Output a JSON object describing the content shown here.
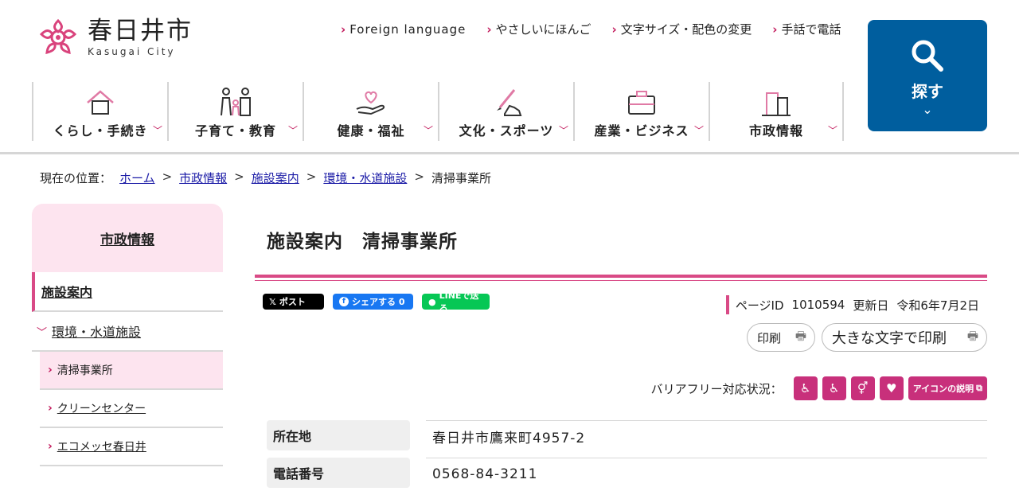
{
  "site": {
    "name_jp": "春日井市",
    "name_en": "Kasugai City",
    "brand_color": "#c2185b",
    "accent_blue": "#005e9e"
  },
  "utility_nav": [
    {
      "label": "Foreign language"
    },
    {
      "label": "やさしいにほんご"
    },
    {
      "label": "文字サイズ・配色の変更"
    },
    {
      "label": "手話で電話"
    }
  ],
  "search": {
    "label": "探す",
    "icon": "magnifier-icon"
  },
  "global_nav": [
    {
      "label": "くらし・手続き",
      "icon": "house-icon"
    },
    {
      "label": "子育て・教育",
      "icon": "family-icon"
    },
    {
      "label": "健康・福祉",
      "icon": "heart-hand-icon"
    },
    {
      "label": "文化・スポーツ",
      "icon": "brush-shoe-icon"
    },
    {
      "label": "産業・ビジネス",
      "icon": "briefcase-icon"
    },
    {
      "label": "市政情報",
      "icon": "building-icon"
    }
  ],
  "breadcrumb": {
    "prefix": "現在の位置：",
    "items": [
      "ホーム",
      "市政情報",
      "施設案内",
      "環境・水道施設"
    ],
    "current": "清掃事業所"
  },
  "sidebar": {
    "heading": "市政情報",
    "level1_active": "施設案内",
    "level1_open": "環境・水道施設",
    "items": [
      "清掃事業所",
      "クリーンセンター",
      "エコメッセ春日井"
    ]
  },
  "page": {
    "title": "施設案内　清掃事業所",
    "page_id_label": "ページID",
    "page_id": "1010594",
    "updated_label": "更新日",
    "updated": "令和6年7月2日"
  },
  "share": {
    "x": "ポスト",
    "facebook": "シェアする 0",
    "line": "LINEで送る"
  },
  "print": {
    "small": "印刷",
    "large": "大きな文字で印刷"
  },
  "barrier_free": {
    "label": "バリアフリー対応状況：",
    "icons": [
      "wheelchair-parking-icon",
      "wheelchair-slope-icon",
      "accessible-toilet-icon",
      "aed-icon"
    ],
    "explain": "アイコンの説明"
  },
  "info_table": [
    {
      "label": "所在地",
      "value": "春日井市鷹来町4957-2"
    },
    {
      "label": "電話番号",
      "value": "0568-84-3211"
    }
  ]
}
